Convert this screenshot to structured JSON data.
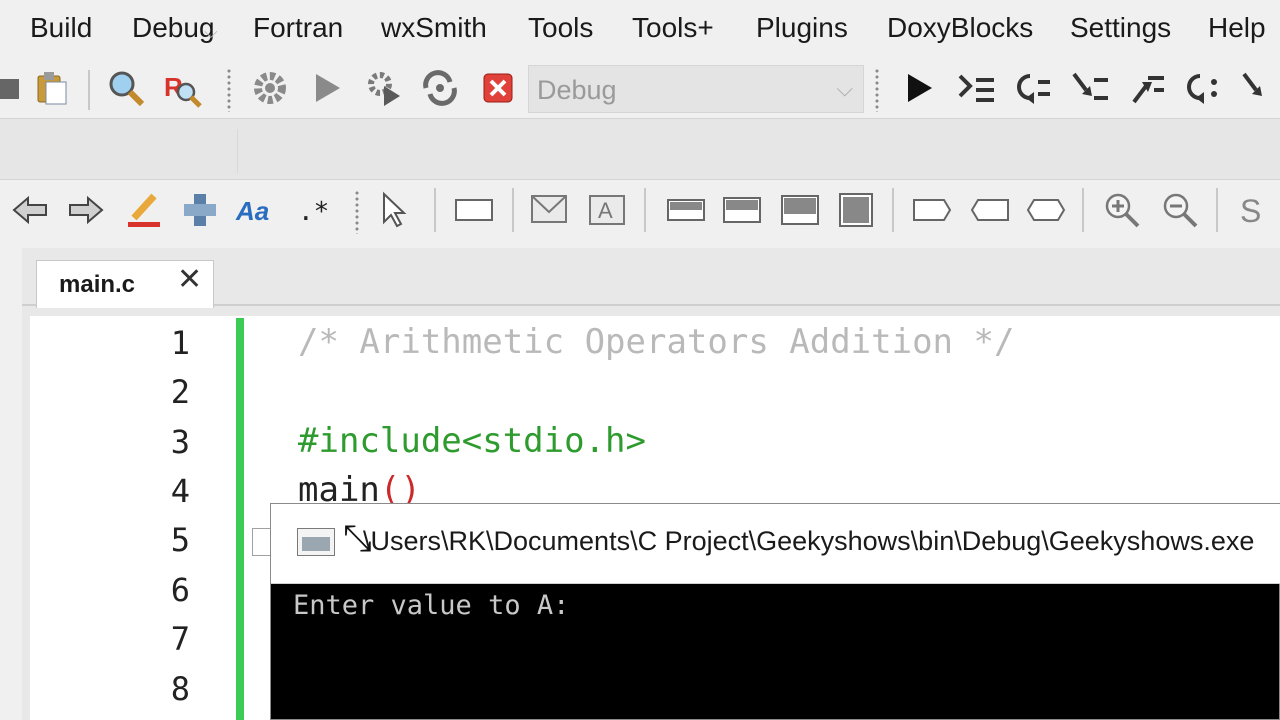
{
  "menubar": {
    "items": [
      "Build",
      "Debug",
      "Fortran",
      "wxSmith",
      "Tools",
      "Tools+",
      "Plugins",
      "DoxyBlocks",
      "Settings",
      "Help"
    ]
  },
  "toolbar1": {
    "build_target": "Debug",
    "icons": [
      "paste-icon",
      "find-icon",
      "replace-icon",
      "settings-build-icon",
      "run-icon",
      "build-and-run-icon",
      "rebuild-icon",
      "abort-icon",
      "debug-run-icon",
      "run-to-cursor-icon",
      "next-line-icon",
      "step-into-icon",
      "step-out-icon",
      "next-instruction-icon",
      "step-into-instruction-icon"
    ]
  },
  "toolbar3": {
    "icons": [
      "back-icon",
      "forward-icon",
      "highlight-icon",
      "tool-icon",
      "match-case-icon",
      "regex-icon",
      "select-icon",
      "rect-icon",
      "email-box-icon",
      "text-box-icon",
      "block-1-icon",
      "block-2-icon",
      "block-3-icon",
      "block-4-icon",
      "shape-1-icon",
      "shape-2-icon",
      "shape-3-icon",
      "zoom-in-icon",
      "zoom-out-icon",
      "s-icon"
    ]
  },
  "editor": {
    "tab_label": "main.c",
    "line_numbers": [
      "1",
      "2",
      "3",
      "4",
      "5",
      "6",
      "7",
      "8"
    ],
    "lines": {
      "l1": "/* Arithmetic Operators Addition */",
      "l3": "#include<stdio.h>",
      "l4_name": "main",
      "l4_parens": "()"
    }
  },
  "console": {
    "title": "\\Users\\RK\\Documents\\C Project\\Geekyshows\\bin\\Debug\\Geekyshows.exe",
    "output": "Enter value to A:"
  },
  "colors": {
    "comment": "#b9b9b9",
    "preprocessor": "#2e9b2e",
    "paren": "#cc2a2a",
    "change_bar": "#3ccc56"
  }
}
